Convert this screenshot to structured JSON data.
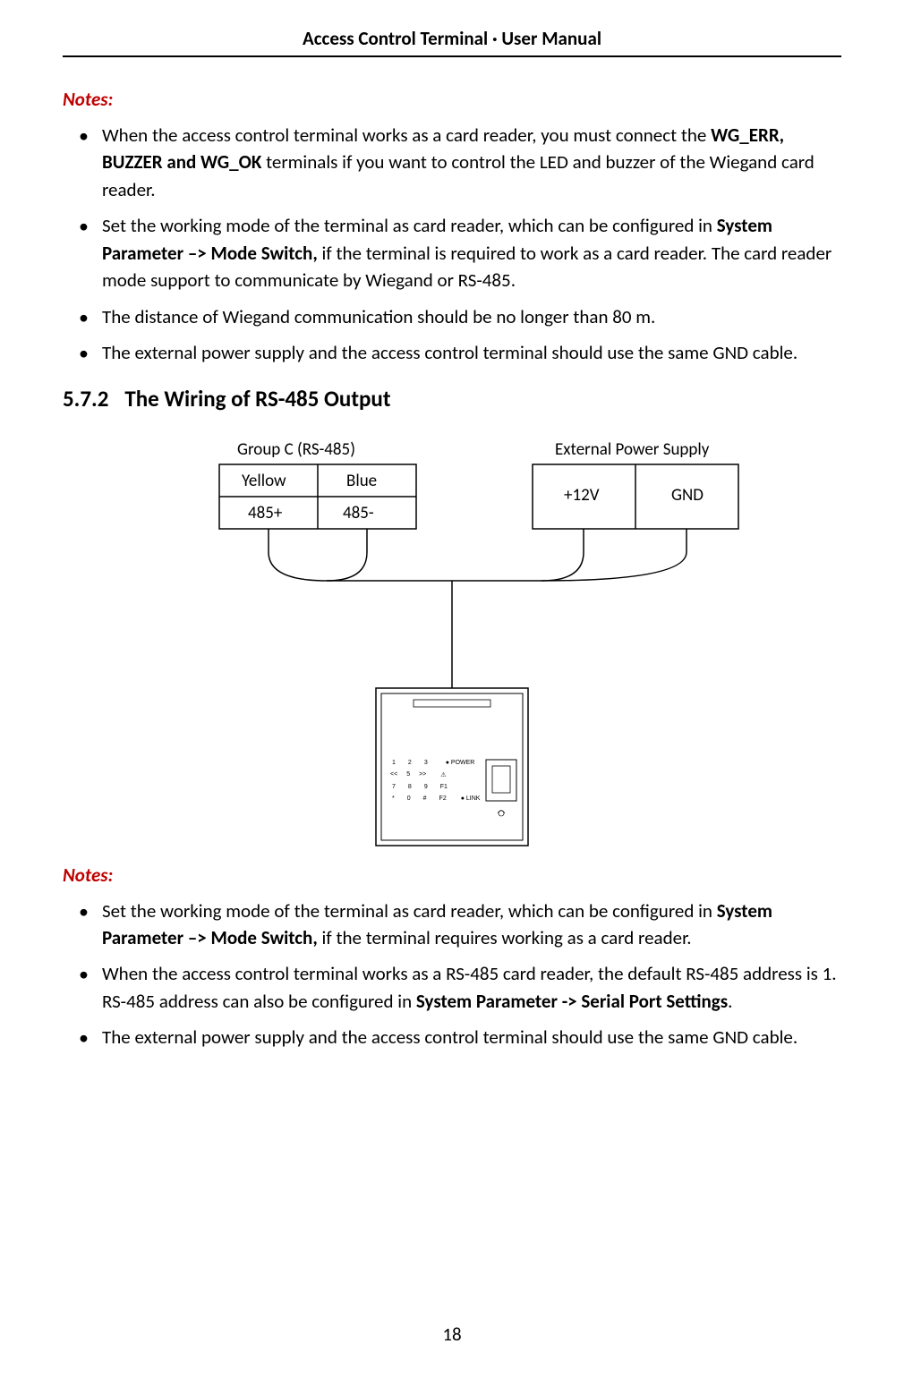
{
  "header": {
    "title": "Access Control Terminal · User Manual"
  },
  "notes1": {
    "label": "Notes:",
    "items": [
      {
        "pre": "When the access control terminal works as a card reader, you must connect the ",
        "bold": "WG_ERR, BUZZER and WG_OK",
        "post": " terminals if you want to control the LED and buzzer of the Wiegand card reader."
      },
      {
        "pre": "Set the working mode of the terminal as card reader, which can be configured in ",
        "bold": "System Parameter –> Mode Switch,",
        "post": " if the terminal is required to work as a card reader. The card reader mode support to communicate by Wiegand or RS-485."
      },
      {
        "pre": "The distance of Wiegand communication should be no longer than 80 m.",
        "bold": "",
        "post": ""
      },
      {
        "pre": "The external power supply and the access control terminal should use the same GND cable.",
        "bold": "",
        "post": ""
      }
    ]
  },
  "section": {
    "number": "5.7.2",
    "title": "The Wiring of RS-485 Output"
  },
  "diagram": {
    "group_left_title": "Group C (RS-485)",
    "group_right_title": "External Power Supply",
    "left_top_left": "Yellow",
    "left_top_right": "Blue",
    "left_bot_left": "485+",
    "left_bot_right": "485-",
    "right_left": "+12V",
    "right_right": "GND",
    "keypad": {
      "r1": [
        "1",
        "2",
        "3"
      ],
      "r2": [
        "<<",
        "5",
        ">>"
      ],
      "r3": [
        "7",
        "8",
        "9",
        "F1"
      ],
      "r4": [
        "*",
        "0",
        "#",
        "F2"
      ],
      "power": "POWER",
      "link": "LINK"
    }
  },
  "notes2": {
    "label": "Notes:",
    "items": [
      {
        "pre": "Set the working mode of the terminal as card reader, which can be configured in ",
        "bold": "System Parameter –> Mode Switch,",
        "post": " if the terminal requires working as a card reader."
      },
      {
        "pre": "When the access control terminal works as a RS-485 card reader, the default RS-485 address is 1. RS-485 address can also be configured in ",
        "bold": "System Parameter -> Serial Port Settings",
        "post": "."
      },
      {
        "pre": "The external power supply and the access control terminal should use the same GND cable.",
        "bold": "",
        "post": ""
      }
    ]
  },
  "footer": {
    "page": "18"
  }
}
